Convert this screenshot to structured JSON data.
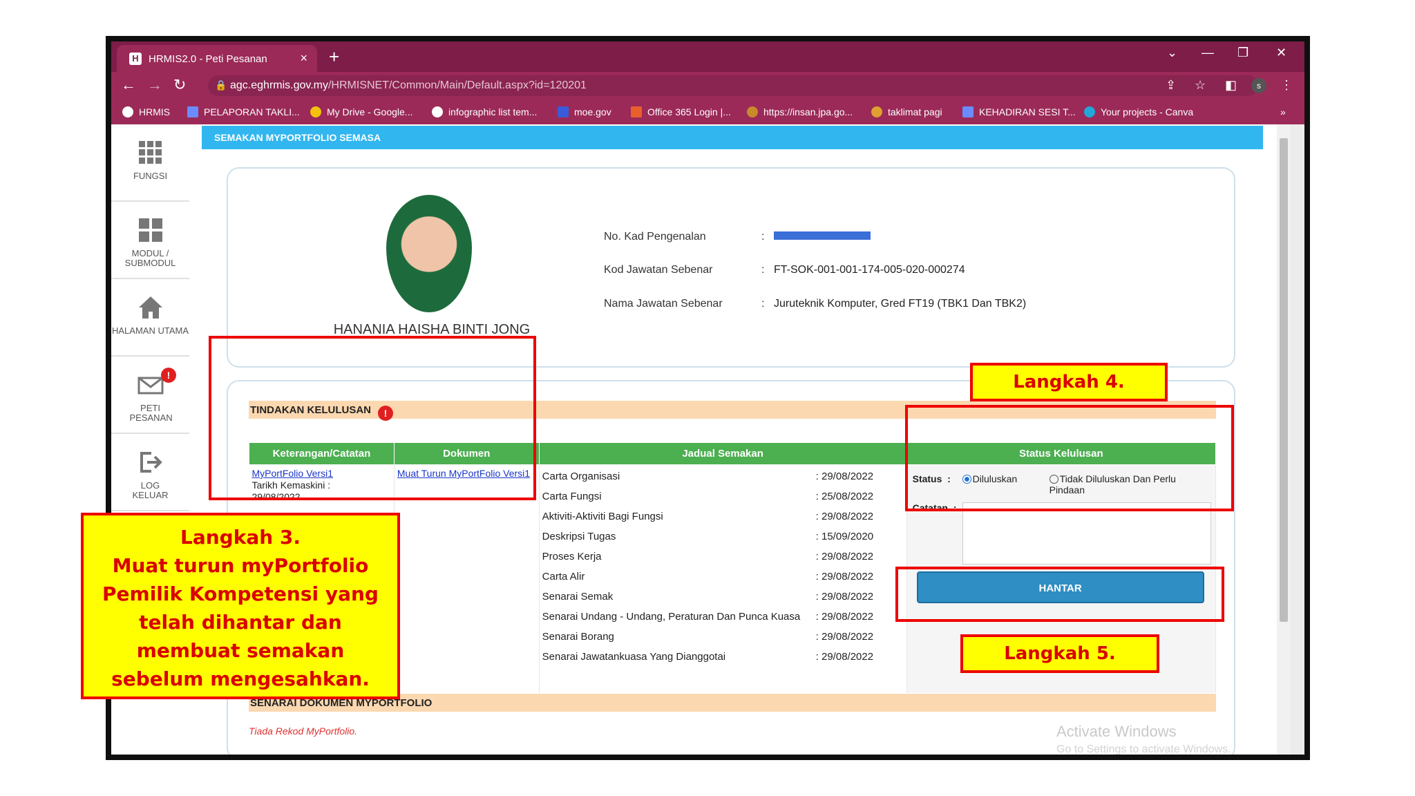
{
  "browser": {
    "tab_title": "HRMIS2.0 - Peti Pesanan",
    "url_host": "agc.eghrmis.gov.my",
    "url_path": "/HRMISNET/Common/Main/Default.aspx?id=120201",
    "profile_initial": "s",
    "bookmarks": [
      "HRMIS",
      "PELAPORAN TAKLI...",
      "My Drive - Google...",
      "infographic list tem...",
      "moe.gov",
      "Office 365 Login |...",
      "https://insan.jpa.go...",
      "taklimat pagi",
      "KEHADIRAN SESI T...",
      "Your projects - Canva"
    ]
  },
  "sidebar": {
    "items": [
      {
        "label": "FUNGSI"
      },
      {
        "label": "MODUL / SUBMODUL"
      },
      {
        "label": "HALAMAN UTAMA"
      },
      {
        "label": "PETI PESANAN"
      },
      {
        "label": "LOG KELUAR"
      }
    ]
  },
  "page": {
    "header": "SEMAKAN MYPORTFOLIO SEMASA",
    "profile": {
      "name": "HANANIA HAISHA BINTI JONG",
      "fields": [
        {
          "label": "No. Kad Pengenalan",
          "value": ""
        },
        {
          "label": "Kod Jawatan Sebenar",
          "value": "FT-SOK-001-001-174-005-020-000274"
        },
        {
          "label": "Nama Jawatan Sebenar",
          "value": "Juruteknik Komputer, Gred FT19 (TBK1 Dan TBK2)"
        }
      ],
      "separator": ":"
    },
    "tindakan": {
      "title": "TINDAKAN KELULUSAN",
      "alert": "!",
      "columns": [
        "Keterangan/Catatan",
        "Dokumen",
        "Jadual Semakan",
        "Status Kelulusan"
      ],
      "keterangan_link": "MyPortFolio Versi1",
      "tarikh_label": "Tarikh Kemaskini :",
      "tarikh_value": "29/08/2022",
      "dokumen_link": "Muat Turun MyPortFolio Versi1",
      "jadual": [
        {
          "item": "Carta Organisasi",
          "date": "29/08/2022"
        },
        {
          "item": "Carta Fungsi",
          "date": "25/08/2022"
        },
        {
          "item": "Aktiviti-Aktiviti Bagi Fungsi",
          "date": "29/08/2022"
        },
        {
          "item": "Deskripsi Tugas",
          "date": "15/09/2020"
        },
        {
          "item": "Proses Kerja",
          "date": "29/08/2022"
        },
        {
          "item": "Carta Alir",
          "date": "29/08/2022"
        },
        {
          "item": "Senarai Semak",
          "date": "29/08/2022"
        },
        {
          "item": "Senarai Undang - Undang, Peraturan Dan Punca Kuasa",
          "date": "29/08/2022"
        },
        {
          "item": "Senarai Borang",
          "date": "29/08/2022"
        },
        {
          "item": "Senarai Jawatankuasa Yang Dianggotai",
          "date": "29/08/2022"
        }
      ],
      "status_label": "Status",
      "option_approved": "Diluluskan",
      "option_rejected": "Tidak Diluluskan Dan Perlu Pindaan",
      "selected_option": "Diluluskan",
      "catatan_label": "Catatan",
      "submit": "HANTAR"
    },
    "senarai": {
      "title": "SENARAI DOKUMEN MYPORTFOLIO",
      "empty": "Tiada Rekod MyPortfolio."
    },
    "watermark": {
      "line1": "Activate Windows",
      "line2": "Go to Settings to activate Windows."
    }
  },
  "annotations": {
    "step3_line1": "Langkah 3.",
    "step3_body": "Muat turun myPortfolio Pemilik Kompetensi yang telah dihantar dan membuat semakan sebelum mengesahkan.",
    "step4": "Langkah 4.",
    "step5": "Langkah 5.",
    "color_box": "#ee0000",
    "color_note_bg": "#ffff00"
  }
}
